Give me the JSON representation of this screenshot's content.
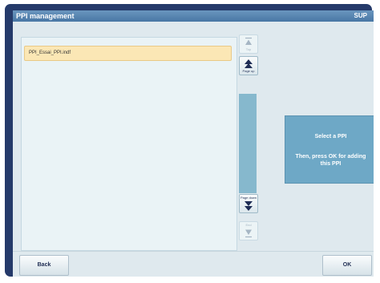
{
  "window": {
    "title": "PPI management",
    "mode_badge": "SUP"
  },
  "list": {
    "items": [
      {
        "label": "PPI_Essai_PPI.indf",
        "selected": true
      }
    ]
  },
  "scroll": {
    "top_label": "Top",
    "page_up_label": "Page up",
    "page_down_label": "Page down",
    "end_label": "End",
    "top_enabled": false,
    "page_up_enabled": true,
    "page_down_enabled": true,
    "end_enabled": false
  },
  "info": {
    "line1": "Select a PPI",
    "line2": "Then, press OK for adding this PPI"
  },
  "footer": {
    "back_label": "Back",
    "ok_label": "OK"
  },
  "colors": {
    "frame": "#253a6a",
    "title_bar": "#4876a4",
    "background": "#dfe9ee",
    "selected_row": "#fbe7b5",
    "info_box": "#6ea8c6",
    "scroll_track": "#86b8cd"
  }
}
